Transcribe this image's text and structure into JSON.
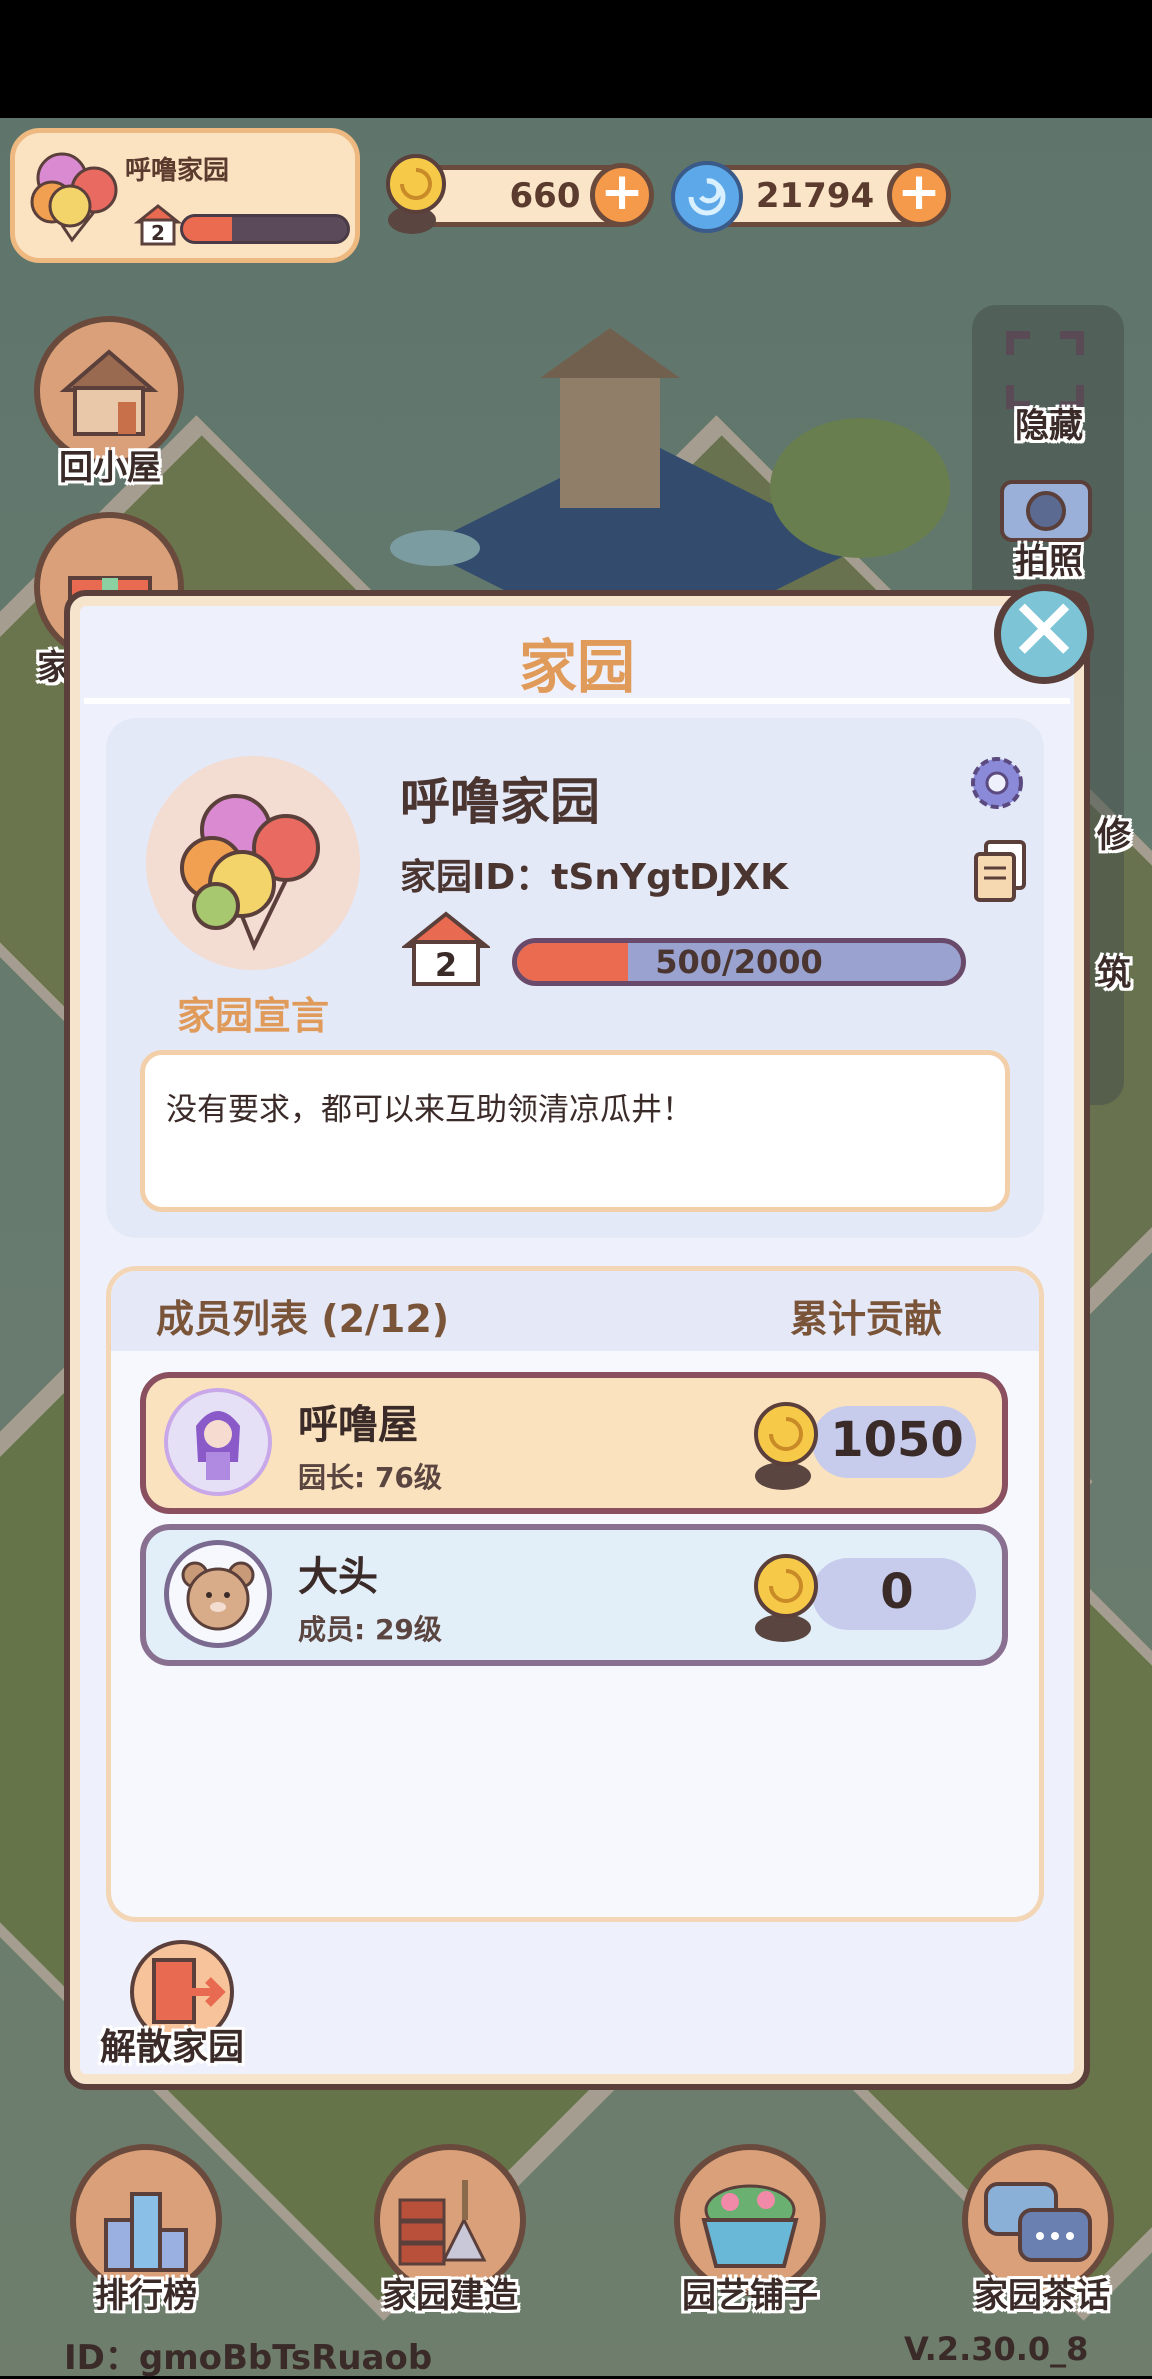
{
  "hud": {
    "home_name": "呼噜家园",
    "home_level": "2",
    "home_level_progress": 0.3,
    "snail_currency": "660",
    "swirl_currency": "21794"
  },
  "side_buttons": {
    "back_house": "回小屋",
    "left_partial": "家",
    "hide": "隐藏",
    "photo": "拍照",
    "right_partial_1": "修",
    "right_partial_2": "筑"
  },
  "dialog": {
    "title": "家园",
    "home_name": "呼噜家园",
    "home_id_label": "家园ID：",
    "home_id_value": "tSnYgtDJXK",
    "level": "2",
    "level_progress_text": "500/2000",
    "level_progress": 0.25,
    "declaration_label": "家园宣言",
    "declaration_text": "没有要求，都可以来互助领清凉瓜井！",
    "member_list_title": "成员列表 (2/12)",
    "contribution_title": "累计贡献",
    "members": [
      {
        "name": "呼噜屋",
        "role": "园长: 76级",
        "contribution": "1050"
      },
      {
        "name": "大头",
        "role": "成员: 29级",
        "contribution": "0"
      }
    ],
    "dissolve_label": "解散家园"
  },
  "bottom_nav": {
    "ranking": "排行榜",
    "build": "家园建造",
    "garden_shop": "园艺铺子",
    "tea_talk": "家园茶话"
  },
  "footer": {
    "player_id": "ID：gmoBbTsRuaob",
    "version": "V.2.30.0_8"
  },
  "colors": {
    "accent_orange": "#e09a5a",
    "progress_red": "#ea6b50",
    "dialog_border": "#5a3f3a"
  }
}
